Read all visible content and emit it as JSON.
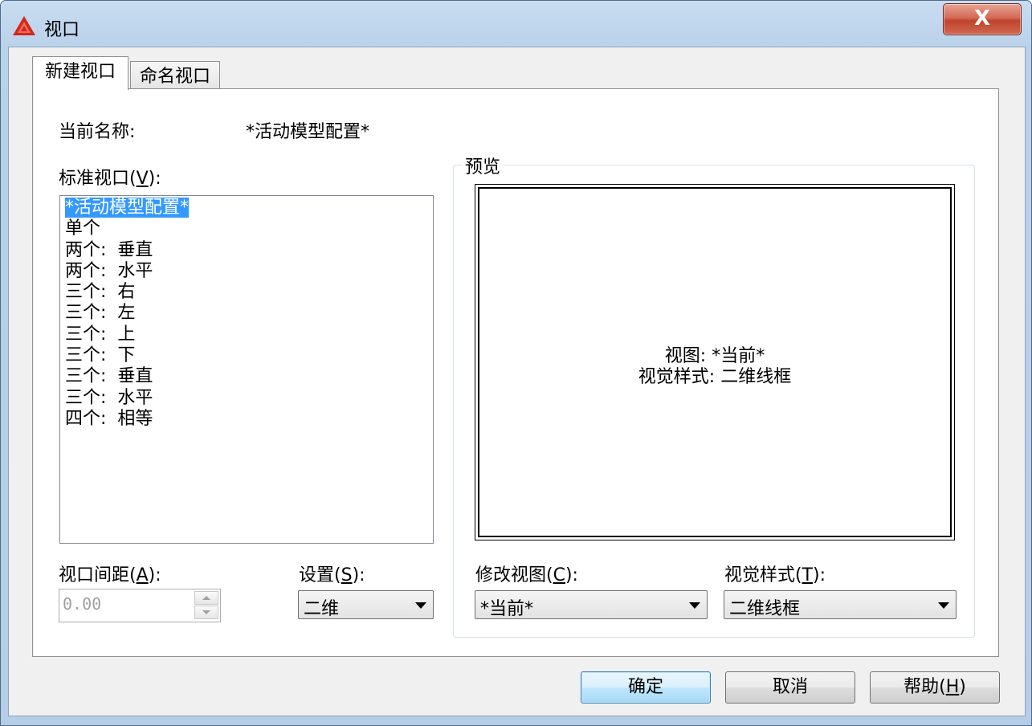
{
  "window": {
    "title": "视口",
    "close_label": "X",
    "brand_color": "#d3271c"
  },
  "tabs": [
    {
      "label": "新建视口",
      "active": true
    },
    {
      "label": "命名视口",
      "active": false
    }
  ],
  "current_name": {
    "label": "当前名称:",
    "value": "*活动模型配置*"
  },
  "standard_viewports": {
    "label_prefix": "标准视口(",
    "label_key": "V",
    "label_suffix": "):",
    "items": [
      "*活动模型配置*",
      "单个",
      "两个:  垂直",
      "两个:  水平",
      "三个:  右",
      "三个:  左",
      "三个:  上",
      "三个:  下",
      "三个:  垂直",
      "三个:  水平",
      "四个:  相等"
    ],
    "selected_index": 0
  },
  "preview": {
    "group_label": "预览",
    "view_line": "视图: *当前*",
    "style_line": "视觉样式: 二维线框"
  },
  "viewport_spacing": {
    "label_prefix": "视口间距(",
    "label_key": "A",
    "label_suffix": "):",
    "value": "0.00"
  },
  "setup": {
    "label_prefix": "设置(",
    "label_key": "S",
    "label_suffix": "):",
    "value": "二维"
  },
  "change_view": {
    "label_prefix": "修改视图(",
    "label_key": "C",
    "label_suffix": "):",
    "value": "*当前*"
  },
  "visual_style": {
    "label_prefix": "视觉样式(",
    "label_key": "T",
    "label_suffix": "):",
    "value": "二维线框"
  },
  "buttons": {
    "ok": "确定",
    "cancel": "取消",
    "help_prefix": "帮助(",
    "help_key": "H",
    "help_suffix": ")"
  }
}
